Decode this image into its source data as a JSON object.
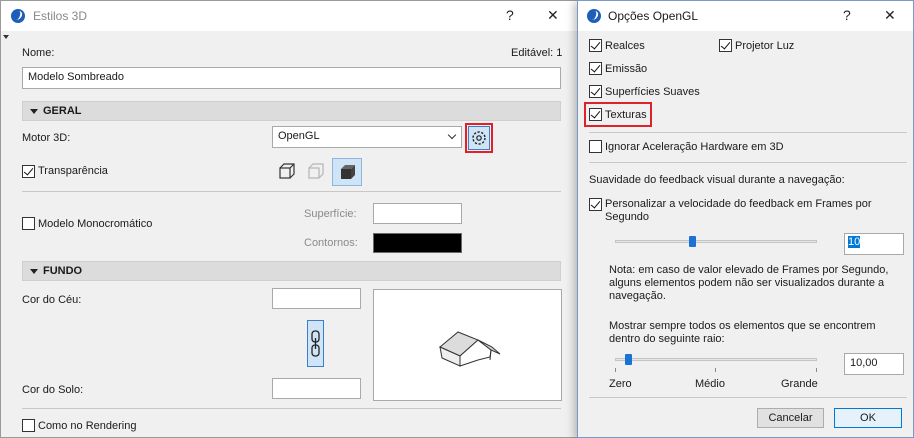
{
  "estilos": {
    "title": "Estilos 3D",
    "help": "?",
    "close": "✕",
    "nome_label": "Nome:",
    "editavel": "Editável: 1",
    "nome_value": "Modelo Sombreado",
    "geral": "GERAL",
    "motor_label": "Motor 3D:",
    "motor_value": "OpenGL",
    "transparencia": "Transparência",
    "monocromatico": "Modelo Monocromático",
    "superficie": "Superfície:",
    "contornos": "Contornos:",
    "fundo": "FUNDO",
    "cor_ceu": "Cor do Céu:",
    "cor_solo": "Cor do Solo:",
    "como_rendering": "Como no Rendering"
  },
  "opengl": {
    "title": "Opções OpenGL",
    "help": "?",
    "close": "✕",
    "realces": "Realces",
    "projetor_luz": "Projetor Luz",
    "emissao": "Emissão",
    "superficies_suaves": "Superfícies Suaves",
    "texturas": "Texturas",
    "ignorar": "Ignorar Aceleração Hardware em 3D",
    "suavidade": "Suavidade do feedback visual durante a navegação:",
    "personalizar_1": "Personalizar a velocidade do feedback em Frames por",
    "personalizar_2": "Segundo",
    "fps_value": "10",
    "nota_1": "Nota: em caso de valor elevado de Frames por Segundo,",
    "nota_2": "alguns elementos podem não ser visualizados durante a",
    "nota_3": "navegação.",
    "mostrar_1": "Mostrar sempre todos os elementos que se encontrem",
    "mostrar_2": "dentro do seguinte raio:",
    "raio_value": "10,00",
    "zero": "Zero",
    "medio": "Médio",
    "grande": "Grande",
    "cancelar": "Cancelar",
    "ok": "OK",
    "fps_slider_level": 0.38,
    "raio_slider_level": 0.05
  }
}
